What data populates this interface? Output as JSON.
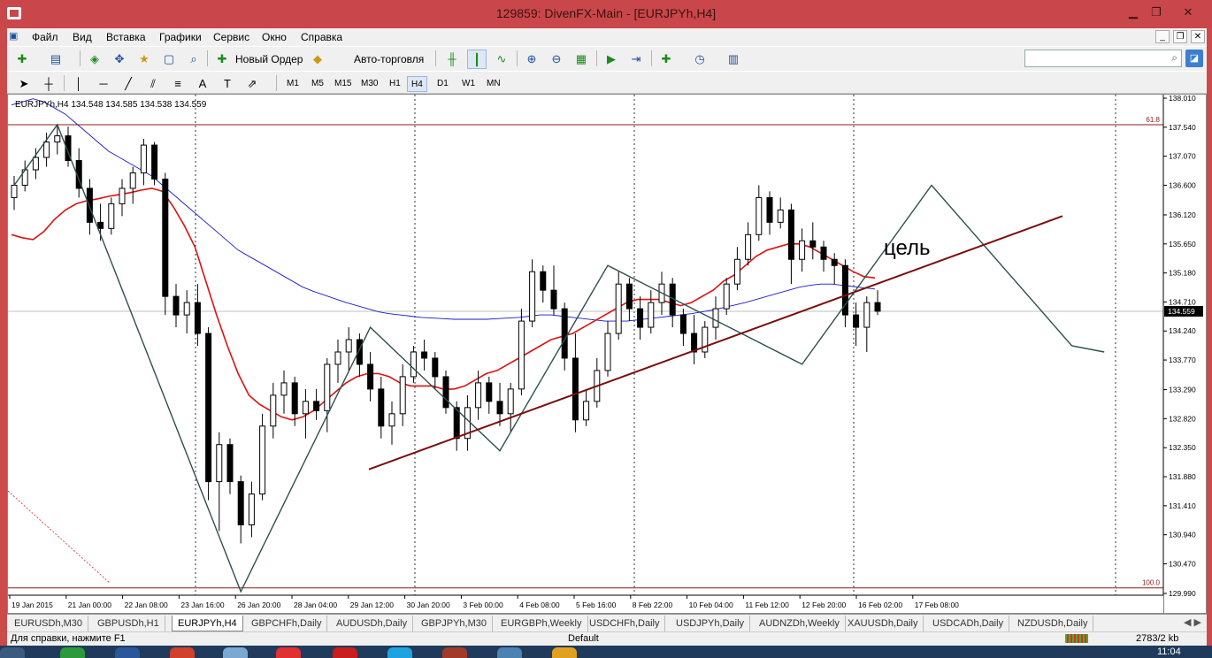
{
  "window": {
    "title": "129859: DivenFX-Main - [EURJPYh,H4]"
  },
  "menu": [
    "Файл",
    "Вид",
    "Вставка",
    "Графики",
    "Сервис",
    "Окно",
    "Справка"
  ],
  "toolbar": {
    "new_order_label": "Новый Ордер",
    "autotrading_label": "Авто-торговля"
  },
  "timeframes": [
    "M1",
    "M5",
    "M15",
    "M30",
    "H1",
    "H4",
    "D1",
    "W1",
    "MN"
  ],
  "active_timeframe": "H4",
  "chart": {
    "header": "EURJPYh,H4  134.548 134.585 134.538 134.559",
    "current_price": "134.559",
    "annotation": "цель",
    "fib_top_label": "61.8",
    "fib_bottom_label": "100.0",
    "price_ticks": [
      "138.010",
      "137.540",
      "137.070",
      "136.600",
      "136.120",
      "135.650",
      "135.180",
      "134.710",
      "134.240",
      "133.770",
      "133.290",
      "132.820",
      "132.350",
      "131.880",
      "131.410",
      "130.940",
      "130.470",
      "129.990"
    ],
    "time_ticks": [
      "19 Jan 2015",
      "21 Jan 00:00",
      "22 Jan 08:00",
      "23 Jan 16:00",
      "26 Jan 20:00",
      "28 Jan 04:00",
      "29 Jan 12:00",
      "30 Jan 20:00",
      "3 Feb 00:00",
      "4 Feb 08:00",
      "5 Feb 16:00",
      "8 Feb 22:00",
      "10 Feb 04:00",
      "11 Feb 12:00",
      "12 Feb 20:00",
      "16 Feb 02:00",
      "17 Feb 08:00"
    ],
    "colors": {
      "ma_fast": "#dd1111",
      "ma_slow": "#1a1acc",
      "zigzag": "#2f4f4f",
      "trendline": "#7a0f0f",
      "fib": "#8b1a1a",
      "bull": "#ffffff",
      "bear": "#000000"
    }
  },
  "chart_data": {
    "type": "candlestick",
    "title": "EURJPYh,H4",
    "ylim": [
      129.99,
      138.01
    ],
    "candles": [
      {
        "t": 0,
        "o": 136.4,
        "h": 136.75,
        "l": 136.2,
        "c": 136.6
      },
      {
        "t": 1,
        "o": 136.6,
        "h": 137.0,
        "l": 136.5,
        "c": 136.85
      },
      {
        "t": 2,
        "o": 136.85,
        "h": 137.2,
        "l": 136.7,
        "c": 137.05
      },
      {
        "t": 3,
        "o": 137.05,
        "h": 137.45,
        "l": 136.9,
        "c": 137.3
      },
      {
        "t": 4,
        "o": 137.3,
        "h": 137.58,
        "l": 137.1,
        "c": 137.4
      },
      {
        "t": 5,
        "o": 137.4,
        "h": 137.55,
        "l": 136.9,
        "c": 137.0
      },
      {
        "t": 6,
        "o": 137.0,
        "h": 137.2,
        "l": 136.4,
        "c": 136.55
      },
      {
        "t": 7,
        "o": 136.55,
        "h": 136.7,
        "l": 135.8,
        "c": 136.0
      },
      {
        "t": 8,
        "o": 136.0,
        "h": 136.3,
        "l": 135.7,
        "c": 135.9
      },
      {
        "t": 9,
        "o": 135.9,
        "h": 136.4,
        "l": 135.8,
        "c": 136.3
      },
      {
        "t": 10,
        "o": 136.3,
        "h": 136.7,
        "l": 136.1,
        "c": 136.55
      },
      {
        "t": 11,
        "o": 136.55,
        "h": 136.9,
        "l": 136.3,
        "c": 136.8
      },
      {
        "t": 12,
        "o": 136.8,
        "h": 137.35,
        "l": 136.6,
        "c": 137.25
      },
      {
        "t": 13,
        "o": 137.25,
        "h": 137.3,
        "l": 136.6,
        "c": 136.7
      },
      {
        "t": 14,
        "o": 136.7,
        "h": 136.8,
        "l": 134.5,
        "c": 134.8
      },
      {
        "t": 15,
        "o": 134.8,
        "h": 135.0,
        "l": 134.3,
        "c": 134.5
      },
      {
        "t": 16,
        "o": 134.5,
        "h": 134.9,
        "l": 134.2,
        "c": 134.7
      },
      {
        "t": 17,
        "o": 134.7,
        "h": 135.0,
        "l": 134.0,
        "c": 134.2
      },
      {
        "t": 18,
        "o": 134.2,
        "h": 134.3,
        "l": 131.5,
        "c": 131.8
      },
      {
        "t": 19,
        "o": 131.8,
        "h": 132.6,
        "l": 131.0,
        "c": 132.4
      },
      {
        "t": 20,
        "o": 132.4,
        "h": 132.5,
        "l": 131.6,
        "c": 131.8
      },
      {
        "t": 21,
        "o": 131.8,
        "h": 131.9,
        "l": 130.8,
        "c": 131.1
      },
      {
        "t": 22,
        "o": 131.1,
        "h": 131.8,
        "l": 130.9,
        "c": 131.6
      },
      {
        "t": 23,
        "o": 131.6,
        "h": 132.9,
        "l": 131.5,
        "c": 132.7
      },
      {
        "t": 24,
        "o": 132.7,
        "h": 133.4,
        "l": 132.5,
        "c": 133.2
      },
      {
        "t": 25,
        "o": 133.2,
        "h": 133.6,
        "l": 132.9,
        "c": 133.4
      },
      {
        "t": 26,
        "o": 133.4,
        "h": 133.5,
        "l": 132.7,
        "c": 132.9
      },
      {
        "t": 27,
        "o": 132.9,
        "h": 133.3,
        "l": 132.5,
        "c": 133.1
      },
      {
        "t": 28,
        "o": 133.1,
        "h": 133.3,
        "l": 132.8,
        "c": 132.95
      },
      {
        "t": 29,
        "o": 132.95,
        "h": 133.8,
        "l": 132.6,
        "c": 133.7
      },
      {
        "t": 30,
        "o": 133.7,
        "h": 134.1,
        "l": 133.4,
        "c": 133.9
      },
      {
        "t": 31,
        "o": 133.9,
        "h": 134.3,
        "l": 133.6,
        "c": 134.1
      },
      {
        "t": 32,
        "o": 134.1,
        "h": 134.2,
        "l": 133.5,
        "c": 133.7
      },
      {
        "t": 33,
        "o": 133.7,
        "h": 133.9,
        "l": 133.1,
        "c": 133.3
      },
      {
        "t": 34,
        "o": 133.3,
        "h": 133.5,
        "l": 132.5,
        "c": 132.7
      },
      {
        "t": 35,
        "o": 132.7,
        "h": 133.1,
        "l": 132.4,
        "c": 132.9
      },
      {
        "t": 36,
        "o": 132.9,
        "h": 133.7,
        "l": 132.7,
        "c": 133.5
      },
      {
        "t": 37,
        "o": 133.5,
        "h": 134.0,
        "l": 133.4,
        "c": 133.9
      },
      {
        "t": 38,
        "o": 133.9,
        "h": 134.1,
        "l": 133.6,
        "c": 133.8
      },
      {
        "t": 39,
        "o": 133.8,
        "h": 133.9,
        "l": 133.3,
        "c": 133.5
      },
      {
        "t": 40,
        "o": 133.5,
        "h": 133.6,
        "l": 132.9,
        "c": 133.0
      },
      {
        "t": 41,
        "o": 133.0,
        "h": 133.1,
        "l": 132.3,
        "c": 132.5
      },
      {
        "t": 42,
        "o": 132.5,
        "h": 133.2,
        "l": 132.3,
        "c": 133.0
      },
      {
        "t": 43,
        "o": 133.0,
        "h": 133.6,
        "l": 132.8,
        "c": 133.4
      },
      {
        "t": 44,
        "o": 133.4,
        "h": 133.5,
        "l": 132.9,
        "c": 133.1
      },
      {
        "t": 45,
        "o": 133.1,
        "h": 133.4,
        "l": 132.7,
        "c": 132.9
      },
      {
        "t": 46,
        "o": 132.9,
        "h": 133.4,
        "l": 132.6,
        "c": 133.3
      },
      {
        "t": 47,
        "o": 133.3,
        "h": 134.6,
        "l": 133.2,
        "c": 134.4
      },
      {
        "t": 48,
        "o": 134.4,
        "h": 135.4,
        "l": 134.3,
        "c": 135.2
      },
      {
        "t": 49,
        "o": 135.2,
        "h": 135.3,
        "l": 134.7,
        "c": 134.9
      },
      {
        "t": 50,
        "o": 134.9,
        "h": 135.3,
        "l": 134.5,
        "c": 134.6
      },
      {
        "t": 51,
        "o": 134.6,
        "h": 134.7,
        "l": 133.6,
        "c": 133.8
      },
      {
        "t": 52,
        "o": 133.8,
        "h": 134.2,
        "l": 132.6,
        "c": 132.8
      },
      {
        "t": 53,
        "o": 132.8,
        "h": 133.3,
        "l": 132.7,
        "c": 133.1
      },
      {
        "t": 54,
        "o": 133.1,
        "h": 133.8,
        "l": 133.0,
        "c": 133.6
      },
      {
        "t": 55,
        "o": 133.6,
        "h": 134.4,
        "l": 133.5,
        "c": 134.2
      },
      {
        "t": 56,
        "o": 134.2,
        "h": 135.2,
        "l": 134.1,
        "c": 135.0
      },
      {
        "t": 57,
        "o": 135.0,
        "h": 135.1,
        "l": 134.4,
        "c": 134.6
      },
      {
        "t": 58,
        "o": 134.6,
        "h": 134.8,
        "l": 134.1,
        "c": 134.3
      },
      {
        "t": 59,
        "o": 134.3,
        "h": 134.9,
        "l": 134.2,
        "c": 134.7
      },
      {
        "t": 60,
        "o": 134.7,
        "h": 135.2,
        "l": 134.5,
        "c": 135.0
      },
      {
        "t": 61,
        "o": 135.0,
        "h": 135.1,
        "l": 134.3,
        "c": 134.5
      },
      {
        "t": 62,
        "o": 134.5,
        "h": 134.6,
        "l": 134.0,
        "c": 134.2
      },
      {
        "t": 63,
        "o": 134.2,
        "h": 134.5,
        "l": 133.7,
        "c": 133.9
      },
      {
        "t": 64,
        "o": 133.9,
        "h": 134.4,
        "l": 133.8,
        "c": 134.3
      },
      {
        "t": 65,
        "o": 134.3,
        "h": 134.8,
        "l": 134.1,
        "c": 134.6
      },
      {
        "t": 66,
        "o": 134.6,
        "h": 135.1,
        "l": 134.5,
        "c": 135.0
      },
      {
        "t": 67,
        "o": 135.0,
        "h": 135.6,
        "l": 134.9,
        "c": 135.4
      },
      {
        "t": 68,
        "o": 135.4,
        "h": 136.0,
        "l": 135.3,
        "c": 135.8
      },
      {
        "t": 69,
        "o": 135.8,
        "h": 136.6,
        "l": 135.7,
        "c": 136.4
      },
      {
        "t": 70,
        "o": 136.4,
        "h": 136.5,
        "l": 135.8,
        "c": 136.0
      },
      {
        "t": 71,
        "o": 136.0,
        "h": 136.4,
        "l": 135.9,
        "c": 136.2
      },
      {
        "t": 72,
        "o": 136.2,
        "h": 136.3,
        "l": 135.0,
        "c": 135.4
      },
      {
        "t": 73,
        "o": 135.4,
        "h": 135.9,
        "l": 135.2,
        "c": 135.7
      },
      {
        "t": 74,
        "o": 135.7,
        "h": 136.0,
        "l": 135.4,
        "c": 135.6
      },
      {
        "t": 75,
        "o": 135.6,
        "h": 135.7,
        "l": 135.2,
        "c": 135.4
      },
      {
        "t": 76,
        "o": 135.4,
        "h": 135.5,
        "l": 135.0,
        "c": 135.3
      },
      {
        "t": 77,
        "o": 135.3,
        "h": 135.4,
        "l": 134.3,
        "c": 134.5
      },
      {
        "t": 78,
        "o": 134.5,
        "h": 134.7,
        "l": 134.0,
        "c": 134.3
      },
      {
        "t": 79,
        "o": 134.3,
        "h": 134.8,
        "l": 133.9,
        "c": 134.7
      },
      {
        "t": 80,
        "o": 134.7,
        "h": 134.9,
        "l": 134.5,
        "c": 134.56
      }
    ],
    "ma_fast": [
      135.8,
      135.75,
      135.72,
      135.85,
      136.05,
      136.2,
      136.3,
      136.35,
      136.38,
      136.42,
      136.45,
      136.48,
      136.52,
      136.55,
      136.5,
      136.25,
      135.95,
      135.6,
      135.05,
      134.5,
      134.0,
      133.55,
      133.2,
      133.05,
      132.95,
      132.85,
      132.8,
      132.85,
      132.95,
      133.1,
      133.25,
      133.4,
      133.5,
      133.55,
      133.55,
      133.5,
      133.4,
      133.35,
      133.35,
      133.35,
      133.3,
      133.3,
      133.35,
      133.45,
      133.55,
      133.6,
      133.7,
      133.8,
      133.9,
      134.0,
      134.1,
      134.15,
      134.2,
      134.3,
      134.4,
      134.5,
      134.6,
      134.7,
      134.75,
      134.75,
      134.75,
      134.7,
      134.65,
      134.7,
      134.8,
      134.9,
      135.05,
      135.15,
      135.3,
      135.45,
      135.55,
      135.6,
      135.65,
      135.65,
      135.6,
      135.5,
      135.4,
      135.3,
      135.2,
      135.12,
      135.1
    ],
    "ma_slow": [
      137.9,
      137.95,
      138.0,
      137.95,
      137.85,
      137.75,
      137.6,
      137.45,
      137.3,
      137.15,
      137.05,
      136.95,
      136.85,
      136.75,
      136.6,
      136.45,
      136.3,
      136.15,
      136.0,
      135.85,
      135.7,
      135.55,
      135.45,
      135.35,
      135.25,
      135.15,
      135.05,
      134.95,
      134.88,
      134.82,
      134.76,
      134.7,
      134.65,
      134.6,
      134.55,
      134.52,
      134.5,
      134.48,
      134.46,
      134.45,
      134.44,
      134.43,
      134.43,
      134.43,
      134.43,
      134.44,
      134.45,
      134.46,
      134.48,
      134.5,
      134.5,
      134.48,
      134.46,
      134.44,
      134.42,
      134.4,
      134.4,
      134.4,
      134.42,
      134.44,
      134.46,
      134.48,
      134.5,
      134.52,
      134.55,
      134.58,
      134.62,
      134.66,
      134.7,
      134.75,
      134.8,
      134.85,
      134.9,
      134.95,
      134.98,
      135.0,
      135.0,
      134.98,
      134.96,
      134.94,
      134.92
    ],
    "zigzag": [
      [
        0,
        136.6
      ],
      [
        4,
        137.58
      ],
      [
        21,
        130.02
      ],
      [
        33,
        134.3
      ],
      [
        45,
        132.3
      ],
      [
        55,
        135.3
      ],
      [
        73,
        133.7
      ],
      [
        85,
        136.6
      ],
      [
        98,
        134.0
      ],
      [
        101,
        133.9
      ]
    ],
    "trendline": [
      [
        40,
        132.0
      ],
      [
        120,
        136.1
      ]
    ],
    "fib_levels": [
      {
        "label": "61.8",
        "value": 137.58
      },
      {
        "label": "100.0",
        "value": 130.08
      }
    ]
  },
  "symbol_tabs": [
    "EURUSDh,M30",
    "GBPUSDh,H1",
    "EURJPYh,H4",
    "GBPCHFh,Daily",
    "AUDUSDh,Daily",
    "GBPJPYh,M30",
    "EURGBPh,Weekly",
    "USDCHFh,Daily",
    "USDJPYh,Daily",
    "AUDNZDh,Weekly",
    "XAUUSDh,Daily",
    "USDCADh,Daily",
    "NZDUSDh,Daily"
  ],
  "active_symbol_tab": "EURJPYh,H4",
  "status": {
    "help": "Для справки, нажмите F1",
    "profile": "Default",
    "traffic": "2783/2 kb",
    "clock": "11:04"
  }
}
